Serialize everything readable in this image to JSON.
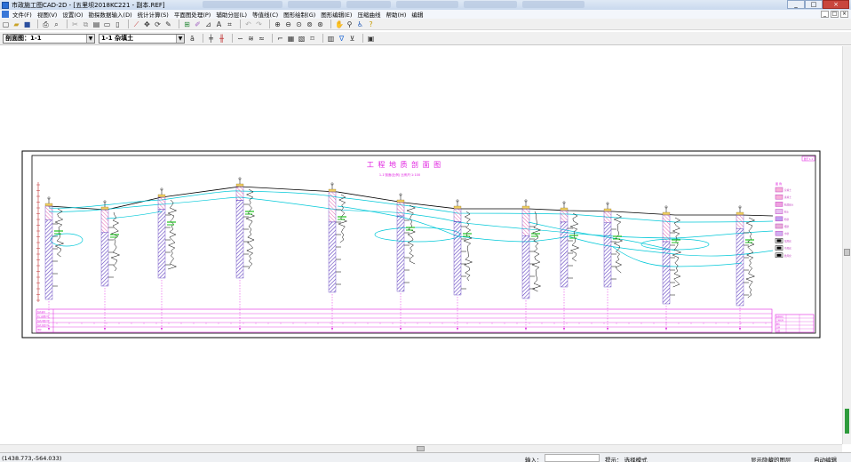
{
  "window": {
    "title": "市政施工图CAD-2D - [五里坝2018KC221 - 副本.REF]",
    "controls": [
      "_",
      "□",
      "×"
    ]
  },
  "menubar": {
    "items": [
      "文件(F)",
      "视图(V)",
      "设置(O)",
      "勘探数据输入(D)",
      "统计计算(S)",
      "平面图处理(P)",
      "辅助分层(L)",
      "等值线(C)",
      "图形绘制(G)",
      "图形编辑(E)",
      "压缩曲线",
      "帮助(H)",
      "编辑"
    ],
    "mdi_controls": [
      "_",
      "□",
      "×"
    ]
  },
  "toolbar2": {
    "section_combo_label": "剖面图：1-1",
    "layer_combo_label": "1-1   杂填土"
  },
  "drawing": {
    "title": "工 程 地 质 剖 面 图",
    "subtitle": "1-1'剖面(比例) 比例尺:1:100",
    "top_right_tag": "图号 1-1",
    "grid_row_labels": [
      "钻孔编号",
      "孔口高程(m)",
      "钻孔间距(m)",
      "钻孔深度(m)",
      "里程"
    ],
    "legend_title": "图 例",
    "legend_items": [
      "杂填土",
      "素填土",
      "粉质粘土",
      "粉土",
      "粉砂",
      "细砂",
      "中砂",
      "强风化",
      "中风化",
      "微风化"
    ],
    "title_block": [
      "勘察单位",
      "工程名称",
      "图名",
      "比例",
      "日期"
    ]
  },
  "status": {
    "coords": "(1438.773,-564.033)",
    "input_label": "输入：",
    "hint": "提示：  选择模式",
    "hidden_layer": "显示隐藏的图层",
    "auto_edit": "自动编辑"
  }
}
